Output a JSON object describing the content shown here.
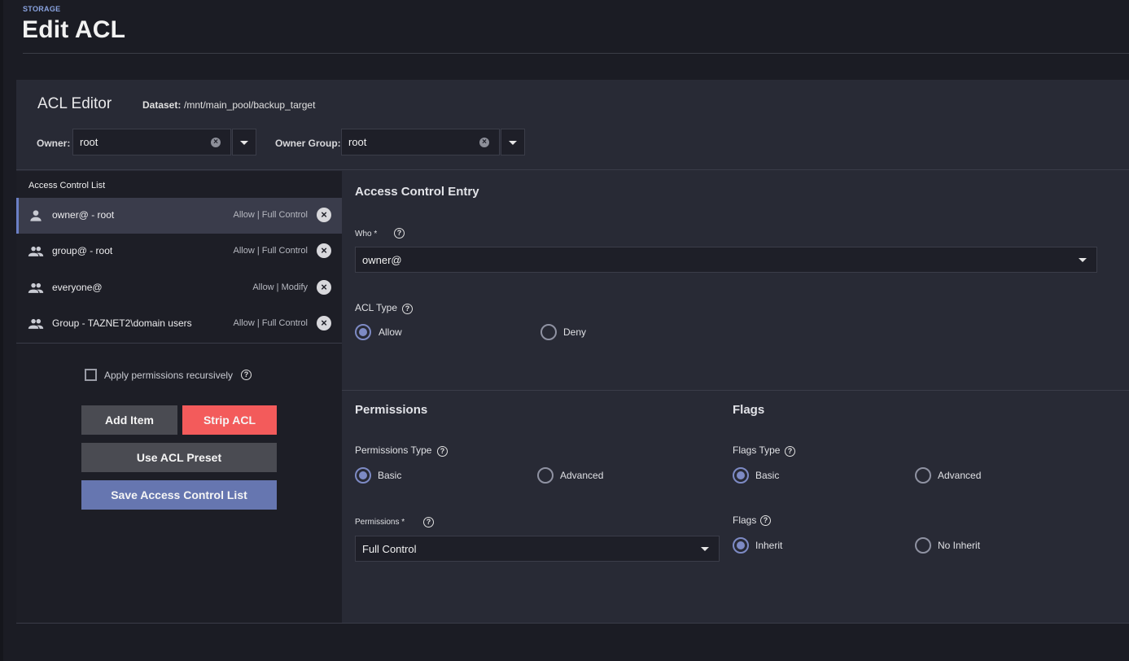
{
  "header": {
    "breadcrumb": "STORAGE",
    "title": "Edit ACL"
  },
  "editor": {
    "title": "ACL Editor",
    "dataset_label": "Dataset:",
    "dataset_path": "/mnt/main_pool/backup_target",
    "owner_label": "Owner:",
    "owner_value": "root",
    "owner_group_label": "Owner Group:",
    "owner_group_value": "root"
  },
  "acl_list": {
    "heading": "Access Control List",
    "items": [
      {
        "name": "owner@ - root",
        "perm": "Allow | Full Control",
        "icon": "person-icon",
        "selected": true
      },
      {
        "name": "group@ - root",
        "perm": "Allow | Full Control",
        "icon": "group-icon",
        "selected": false
      },
      {
        "name": "everyone@",
        "perm": "Allow | Modify",
        "icon": "group-icon",
        "selected": false
      },
      {
        "name": "Group - TAZNET2\\domain users",
        "perm": "Allow | Full Control",
        "icon": "group-icon",
        "selected": false
      }
    ]
  },
  "recursive": {
    "label": "Apply permissions recursively",
    "checked": false
  },
  "buttons": {
    "add_item": "Add Item",
    "strip_acl": "Strip ACL",
    "use_preset": "Use ACL Preset",
    "save": "Save Access Control List"
  },
  "entry": {
    "title": "Access Control Entry",
    "who_label": "Who *",
    "who_value": "owner@",
    "acl_type_label": "ACL Type",
    "acl_type_options": [
      "Allow",
      "Deny"
    ],
    "acl_type_selected": "Allow"
  },
  "permissions": {
    "title": "Permissions",
    "type_label": "Permissions Type",
    "type_options": [
      "Basic",
      "Advanced"
    ],
    "type_selected": "Basic",
    "perm_label": "Permissions *",
    "perm_value": "Full Control"
  },
  "flags": {
    "title": "Flags",
    "type_label": "Flags Type",
    "type_options": [
      "Basic",
      "Advanced"
    ],
    "type_selected": "Basic",
    "flags_label": "Flags",
    "flags_options": [
      "Inherit",
      "No Inherit"
    ],
    "flags_selected": "Inherit"
  },
  "colors": {
    "accent": "#6676b0",
    "danger": "#f35b5b",
    "background": "#1b1c24",
    "card": "#282a35"
  }
}
